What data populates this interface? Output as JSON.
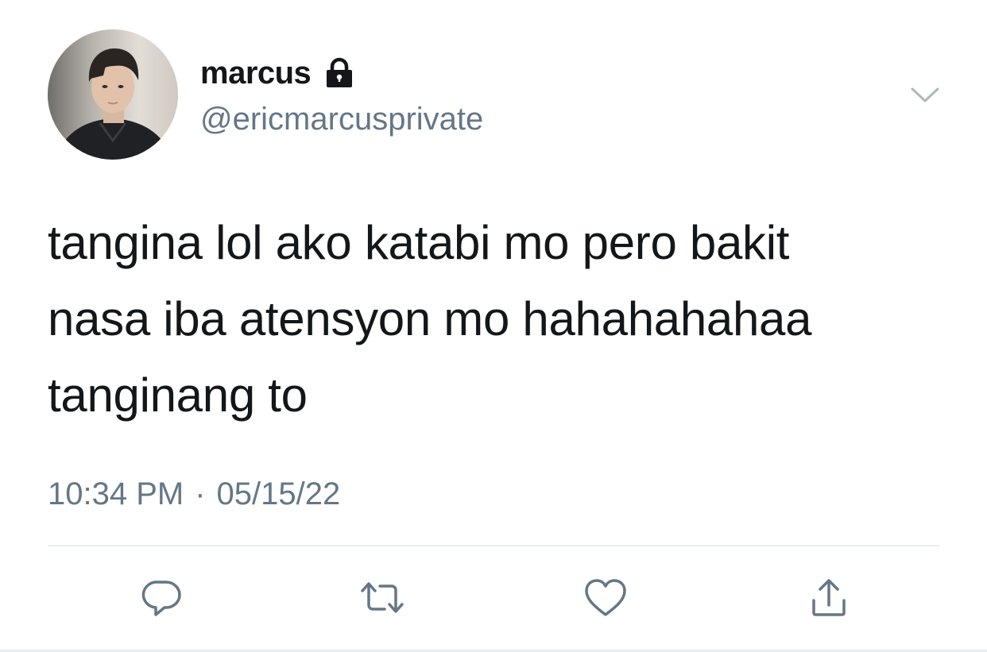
{
  "user": {
    "display_name": "marcus",
    "handle": "@ericmarcusprivate",
    "protected_icon": "lock-icon",
    "avatar_icon": "avatar"
  },
  "tweet": {
    "text": "tangina lol ako katabi mo pero bakit\nnasa iba atensyon mo hahahahahaa\ntanginang to",
    "time": "10:34 PM",
    "separator": "·",
    "date": "05/15/22"
  },
  "actions": [
    {
      "name": "reply",
      "icon": "reply-icon"
    },
    {
      "name": "retweet",
      "icon": "retweet-icon"
    },
    {
      "name": "like",
      "icon": "heart-icon"
    },
    {
      "name": "share",
      "icon": "share-icon"
    }
  ],
  "menu": {
    "icon": "chevron-down-icon"
  },
  "colors": {
    "text": "#14171a",
    "secondary": "#657786",
    "divider": "#e6ecf0",
    "icon": "#657786"
  }
}
